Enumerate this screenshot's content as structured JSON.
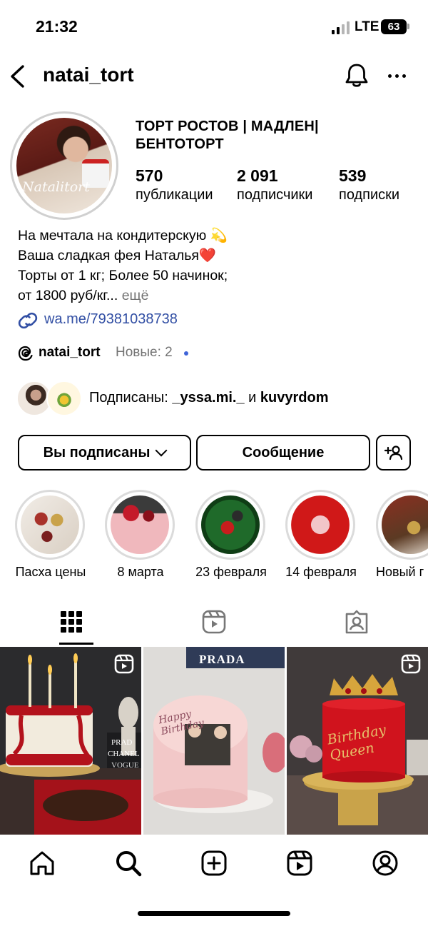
{
  "status_bar": {
    "time": "21:32",
    "network": "LTE",
    "battery": "63",
    "icons": [
      "signal-icon",
      "battery-icon"
    ]
  },
  "header": {
    "username": "natai_tort",
    "icons": [
      "back-icon",
      "bell-icon",
      "more-icon"
    ]
  },
  "profile": {
    "name": "ТОРТ РОСТОВ | МАДЛЕН| БЕНТОТОРТ",
    "avatar_script": "Natalitort",
    "stats": [
      {
        "value": "570",
        "label": "публикации"
      },
      {
        "value": "2 091",
        "label": "подписчики"
      },
      {
        "value": "539",
        "label": "подписки"
      }
    ],
    "bio_lines": [
      "На мечтала на кондитерскую 💫",
      "Ваша сладкая фея Наталья❤️",
      "Торты от 1 кг; Более 50 начинок;",
      "от 1800 руб/кг..."
    ],
    "bio_more": "ещё",
    "link": "wa.me/79381038738",
    "threads": {
      "name": "natai_tort",
      "new_label": "Новые: 2"
    }
  },
  "mutual": {
    "prefix": "Подписаны:",
    "user1": "_yssa.mi._",
    "conjunction": "и",
    "user2": "kuvyrdom"
  },
  "actions": {
    "follow_label": "Вы подписаны",
    "message_label": "Сообщение",
    "add_icon": "add-person-icon"
  },
  "highlights": [
    {
      "label": "Пасха цены"
    },
    {
      "label": "8 марта"
    },
    {
      "label": "23 февраля"
    },
    {
      "label": "14 февраля"
    },
    {
      "label": "Новый г"
    }
  ],
  "tabs": [
    "grid-icon",
    "reels-icon",
    "tagged-icon"
  ],
  "grid": {
    "tile2_text": "PRADA",
    "tile2_cake_text": "Happy Birthday",
    "tile3_cake_text": "Birthday Queen",
    "tile1_brand_text": "CHANEL",
    "tile1_brand_text2": "VOGUE",
    "tile1_brand_text3": "PRAD"
  },
  "bottom_nav": [
    "home-icon",
    "search-icon",
    "create-icon",
    "reels-icon",
    "profile-icon"
  ],
  "colors": {
    "link": "#324fa4",
    "muted": "#737373",
    "threads_dot": "#3f64d8"
  }
}
